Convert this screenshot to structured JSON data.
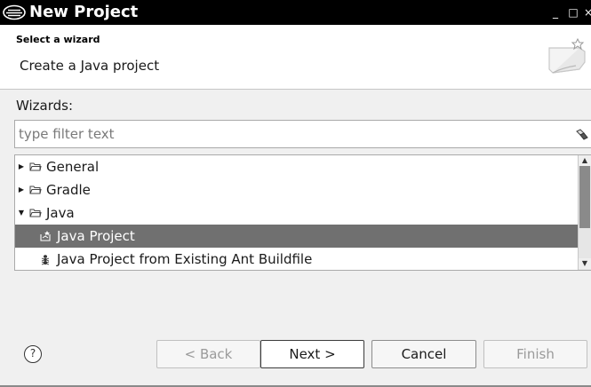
{
  "window": {
    "title": "New Project",
    "controls": {
      "minimize": "_",
      "maximize": "□",
      "close": "×"
    }
  },
  "header": {
    "title": "Select a wizard",
    "description": "Create a Java project",
    "banner_icon": "new-project-wizard-icon"
  },
  "wizards": {
    "label": "Wizards:",
    "filter_placeholder": "type filter text",
    "filter_value": "",
    "clear_icon": "eraser-icon"
  },
  "tree": {
    "items": [
      {
        "label": "General",
        "expanded": false,
        "icon": "folder-icon",
        "level": 0
      },
      {
        "label": "Gradle",
        "expanded": false,
        "icon": "folder-icon",
        "level": 0
      },
      {
        "label": "Java",
        "expanded": true,
        "icon": "folder-icon",
        "level": 0
      },
      {
        "label": "Java Project",
        "selected": true,
        "icon": "java-project-icon",
        "level": 1
      },
      {
        "label": "Java Project from Existing Ant Buildfile",
        "selected": false,
        "icon": "ant-icon",
        "level": 1
      }
    ]
  },
  "footer": {
    "help": "?",
    "back": "< Back",
    "next": "Next >",
    "cancel": "Cancel",
    "finish": "Finish"
  },
  "colors": {
    "titlebar": "#000000",
    "selection": "#707070",
    "dialog_bg": "#f0f0f0"
  }
}
